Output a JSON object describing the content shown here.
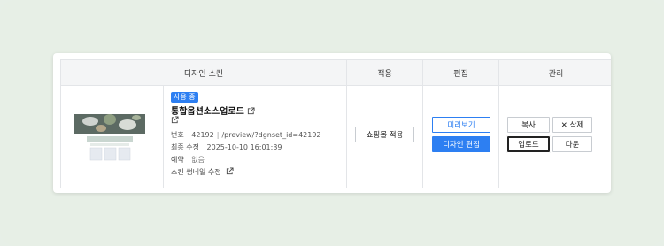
{
  "table": {
    "headers": {
      "design_skin": "디자인 스킨",
      "apply": "적용",
      "edit": "편집",
      "manage": "관리"
    }
  },
  "skin": {
    "badge": "사용 중",
    "name": "통합옵션소스업로드",
    "number_label": "번호",
    "number_value": "42192",
    "preview_path": "/preview/?dgnset_id=42192",
    "modified_label": "최종 수정",
    "modified_value": "2025-10-10 16:01:39",
    "reserve_label": "예약",
    "reserve_value": "없음",
    "thumbnail_edit": "스킨 썸네일 수정"
  },
  "actions": {
    "apply_shopping": "쇼핑몰 적용",
    "preview": "미리보기",
    "design_edit": "디자인 편집",
    "copy": "복사",
    "delete": "✕ 삭제",
    "upload": "업로드",
    "download": "다운"
  },
  "colors": {
    "accent": "#2d7ff2",
    "background": "#e7efe7"
  },
  "icons": {
    "external_link": "external-link-icon"
  }
}
